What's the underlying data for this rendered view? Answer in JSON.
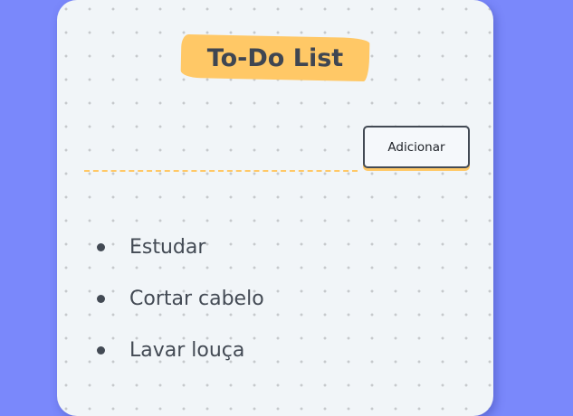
{
  "app": {
    "title": "To-Do List"
  },
  "form": {
    "input_value": "",
    "input_placeholder": "",
    "add_label": "Adicionar"
  },
  "tasks": [
    {
      "text": "Estudar"
    },
    {
      "text": "Cortar cabelo"
    },
    {
      "text": "Lavar louça"
    }
  ],
  "colors": {
    "page_background": "#7a88fb",
    "card_background": "#f1f5f8",
    "accent": "#ffc866",
    "text": "#434a54",
    "border": "#434a54"
  }
}
